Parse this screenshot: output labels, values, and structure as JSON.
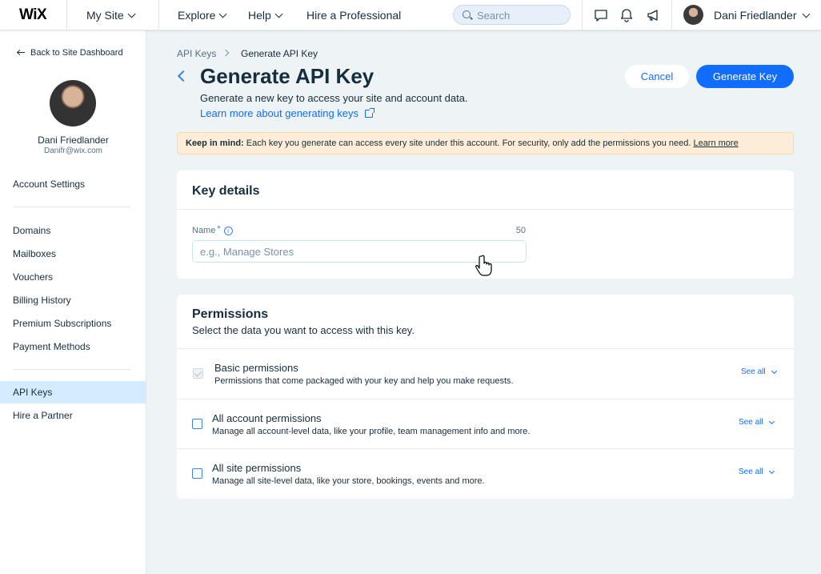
{
  "topbar": {
    "logo": "WiX",
    "site_menu": "My Site",
    "explore": "Explore",
    "help": "Help",
    "hire": "Hire a Professional",
    "search_placeholder": "Search",
    "user_name": "Dani Friedlander"
  },
  "sidebar": {
    "back": "Back to Site Dashboard",
    "user_name": "Dani Friedlander",
    "user_email": "Danifr@wix.com",
    "items": [
      {
        "label": "Account Settings"
      },
      {
        "label": "Domains"
      },
      {
        "label": "Mailboxes"
      },
      {
        "label": "Vouchers"
      },
      {
        "label": "Billing History"
      },
      {
        "label": "Premium Subscriptions"
      },
      {
        "label": "Payment Methods"
      },
      {
        "label": "API Keys"
      },
      {
        "label": "Hire a Partner"
      }
    ]
  },
  "breadcrumb": {
    "parent": "API Keys",
    "current": "Generate API Key"
  },
  "header": {
    "title": "Generate API Key",
    "subtitle": "Generate a new key to access your site and account data.",
    "learn_link": "Learn more about generating keys",
    "cancel": "Cancel",
    "generate": "Generate Key"
  },
  "notice": {
    "bold": "Keep in mind:",
    "text": "Each key you generate can access every site under this account. For security, only add the permissions you need.",
    "link": "Learn more"
  },
  "key_details": {
    "title": "Key details",
    "name_label": "Name",
    "required_mark": "*",
    "char_limit": "50",
    "name_placeholder": "e.g., Manage Stores",
    "name_value": ""
  },
  "permissions": {
    "title": "Permissions",
    "subtitle": "Select the data you want to access with this key.",
    "see_all": "See all",
    "rows": [
      {
        "title": "Basic permissions",
        "desc": "Permissions that come packaged with your key and help you make requests.",
        "checked": true,
        "disabled": true
      },
      {
        "title": "All account permissions",
        "desc": "Manage all account-level data, like your profile, team management info and more.",
        "checked": false,
        "disabled": false
      },
      {
        "title": "All site permissions",
        "desc": "Manage all site-level data, like your store, bookings, events and more.",
        "checked": false,
        "disabled": false
      }
    ]
  },
  "colors": {
    "accent": "#116dff",
    "active_sidebar": "#d3edff",
    "notice_bg": "#feedd6",
    "page_bg": "#eef3f6"
  }
}
